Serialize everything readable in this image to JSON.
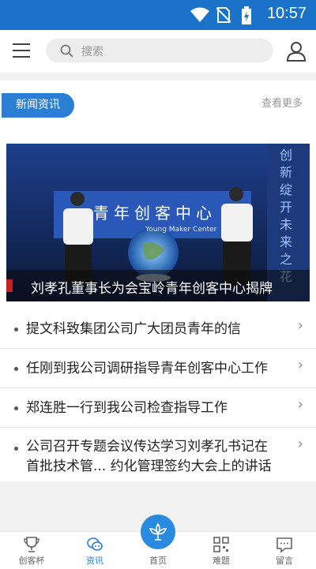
{
  "status_bar": {
    "time": "10:57"
  },
  "search": {
    "placeholder": "搜索"
  },
  "section": {
    "tab_label": "新闻资讯",
    "more_label": "查看更多"
  },
  "banner": {
    "caption": "刘孝孔董事长为会宝岭青年创客中心揭牌",
    "sign_text": "青年创客中心",
    "sign_sub": "Young Maker Center",
    "side_text": "创新绽开未来之花"
  },
  "news": [
    {
      "title": "提文科致集团公司广大团员青年的信"
    },
    {
      "title": "任刚到我公司调研指导青年创客中心工作"
    },
    {
      "title": "郑连胜一行到我公司检查指导工作"
    },
    {
      "title_line1": "公司召开专题会议传达学习刘孝孔书记在",
      "title_line2": "首批技术管... 约化管理签约大会上的讲话"
    }
  ],
  "nav": [
    {
      "label": "创客杯",
      "icon": "trophy-icon"
    },
    {
      "label": "资讯",
      "icon": "chat-icon",
      "active": true
    },
    {
      "label": "首页",
      "icon": "home-flower-icon"
    },
    {
      "label": "难题",
      "icon": "qrcode-icon"
    },
    {
      "label": "留言",
      "icon": "message-icon"
    }
  ],
  "colors": {
    "primary": "#1a73c9",
    "accent": "#2a7fd4"
  }
}
